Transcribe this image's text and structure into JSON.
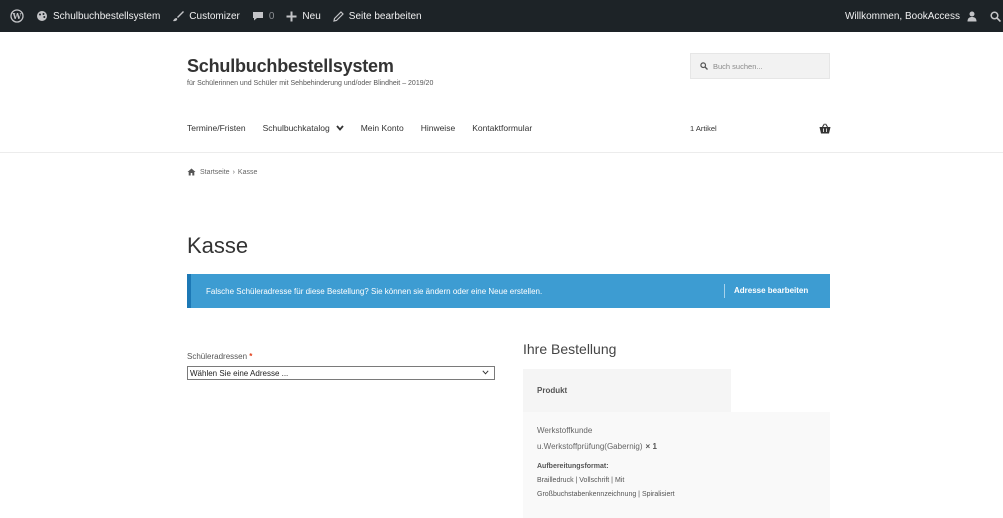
{
  "colors": {
    "adminbar": "#1d2327",
    "notice": "#3d9cd2",
    "required": "#e2401c"
  },
  "adminbar": {
    "items": [
      {
        "icon": "wordpress-icon",
        "label": ""
      },
      {
        "icon": "palette-icon",
        "label": "Schulbuchbestellsystem"
      },
      {
        "icon": "brush-icon",
        "label": "Customizer"
      },
      {
        "icon": "comment-icon",
        "label": "0"
      },
      {
        "icon": "plus-icon",
        "label": "Neu"
      },
      {
        "icon": "pencil-icon",
        "label": "Seite bearbeiten"
      }
    ],
    "greeting": "Willkommen, BookAccess"
  },
  "header": {
    "site_title": "Schulbuchbestellsystem",
    "tagline": "für Schülerinnen und Schüler mit Sehbehinderung und/oder Blindheit – 2019/20",
    "search_placeholder": "Buch suchen..."
  },
  "nav": {
    "items": [
      "Termine/Fristen",
      "Schulbuchkatalog",
      "Mein Konto",
      "Hinweise",
      "Kontaktformular"
    ],
    "cart_count": "1 Artikel"
  },
  "breadcrumb": {
    "home": "Startseite",
    "separator": "›",
    "current": "Kasse"
  },
  "page_title": "Kasse",
  "notice": {
    "message": "Falsche Schüleradresse für diese Bestellung? Sie können sie ändern oder eine Neue erstellen.",
    "button": "Adresse bearbeiten"
  },
  "form": {
    "address_label": "Schüleradressen",
    "required_mark": "*",
    "address_select_value": "Wählen Sie eine Adresse ..."
  },
  "order": {
    "heading": "Ihre Bestellung",
    "column_product": "Produkt",
    "product_line1": "Werkstoffkunde",
    "product_line2": "u.Werkstoffprüfung(Gabernig)",
    "quantity": "× 1",
    "format_label": "Aufbereitungsformat:",
    "format_line1": "Brailledruck | Vollschrift | Mit",
    "format_line2": "Großbuchstabenkennzeichnung | Spiralisiert"
  }
}
